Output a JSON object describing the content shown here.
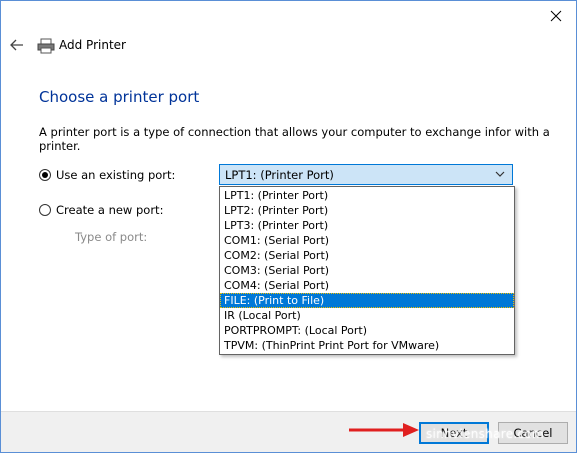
{
  "window": {
    "title": "Add Printer",
    "close_icon": "close-icon",
    "back_icon": "back-arrow-icon",
    "printer_icon": "printer-icon"
  },
  "page": {
    "heading": "Choose a printer port",
    "description": "A printer port is a type of connection that allows your computer to exchange infor with a printer."
  },
  "options": {
    "existing_label": "Use an existing port:",
    "existing_selected": true,
    "new_label": "Create a new port:",
    "new_selected": false,
    "type_label": "Type of port:"
  },
  "port_select": {
    "value": "LPT1: (Printer Port)",
    "items": [
      "LPT1: (Printer Port)",
      "LPT2: (Printer Port)",
      "LPT3: (Printer Port)",
      "COM1: (Serial Port)",
      "COM2: (Serial Port)",
      "COM3: (Serial Port)",
      "COM4: (Serial Port)",
      "FILE: (Print to File)",
      "IR (Local Port)",
      "PORTPROMPT: (Local Port)",
      "TPVM: (ThinPrint Print Port for VMware)"
    ],
    "highlighted_index": 7
  },
  "footer": {
    "next_label": "Next",
    "cancel_label": "Cancel"
  },
  "annotation": {
    "arrow_color": "#e02020",
    "watermark": "sinhvienshare.com"
  },
  "colors": {
    "accent": "#0078d7",
    "heading": "#003399"
  }
}
